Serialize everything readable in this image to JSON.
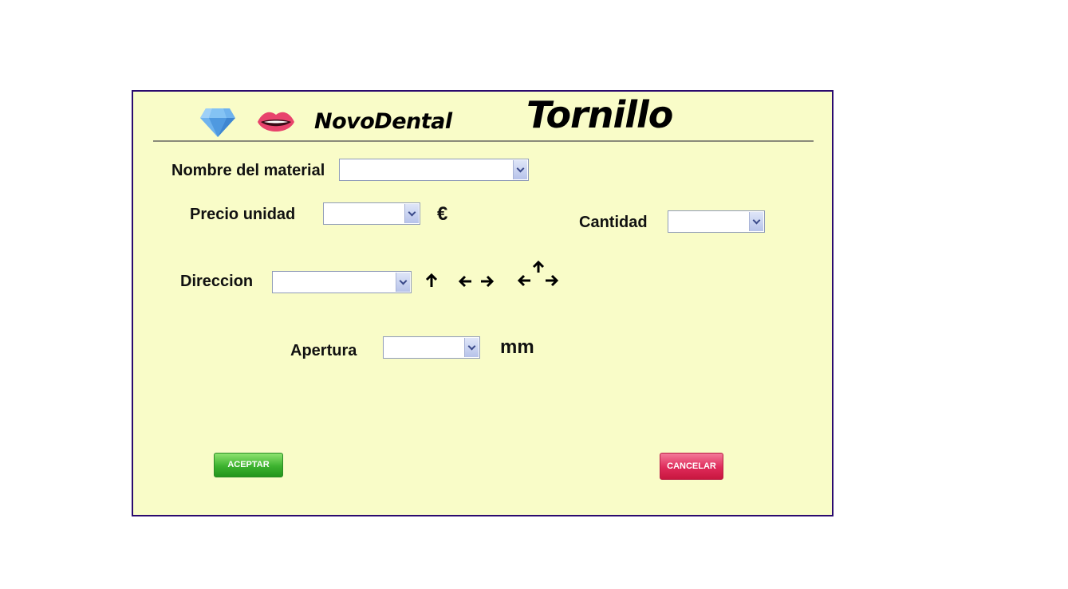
{
  "header": {
    "logo_gem_icon": "diamond-icon",
    "logo_mouth_icon": "lips-icon",
    "brand": "NovoDental",
    "title": "Tornillo"
  },
  "form": {
    "material": {
      "label": "Nombre del material",
      "value": ""
    },
    "precio": {
      "label": "Precio unidad",
      "value": "",
      "unit": "€"
    },
    "cantidad": {
      "label": "Cantidad",
      "value": ""
    },
    "direccion": {
      "label": "Direccion",
      "value": "",
      "icons": [
        "arrow-up-icon",
        "arrows-left-right-icon",
        "arrows-up-left-right-icon"
      ]
    },
    "apertura": {
      "label": "Apertura",
      "value": "",
      "unit": "mm"
    }
  },
  "buttons": {
    "accept": "ACEPTAR",
    "cancel": "CANCELAR"
  },
  "colors": {
    "panel_bg": "#f9fcc8",
    "panel_border": "#2a0a6e",
    "accept": "#3db22f",
    "cancel": "#df2a5a"
  }
}
